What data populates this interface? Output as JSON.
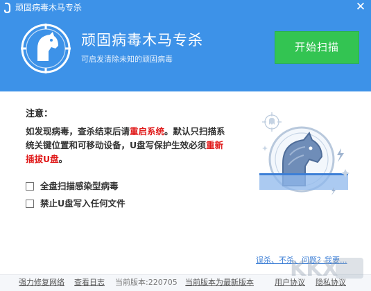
{
  "window": {
    "title": "顽固病毒木马专杀",
    "close_glyph": "✕"
  },
  "hero": {
    "title": "顽固病毒木马专杀",
    "subtitle": "可启发清除未知的顽固病毒",
    "scan_button": "开始扫描"
  },
  "notice": {
    "heading": "注意：",
    "text_1": "如发现病毒，查杀结束后请",
    "text_red_1": "重启系统",
    "text_2": "。默认只扫描系统关键位置和可移动设备，U盘写保护生效必须",
    "text_red_2": "重新插拔U盘",
    "text_3": "。"
  },
  "options": [
    {
      "label": "全盘扫描感染型病毒",
      "checked": false
    },
    {
      "label": "禁止U盘写入任何文件",
      "checked": false
    }
  ],
  "feedback_link": "误杀、不杀、问题？我要...",
  "footer": {
    "repair": "强力修复网络",
    "log": "查看日志",
    "version": "当前版本:220705",
    "latest": "当前版本为最新版本",
    "agreement": "用户协议",
    "privacy": "隐私协议"
  },
  "watermark_text": "KKX下载",
  "colors": {
    "header_blue": "#3d92e8",
    "scan_green": "#33c452",
    "warning_red": "#e01a1a",
    "link_blue": "#3d7fd6"
  },
  "icons": {
    "app_logo": "app-logo-icon",
    "hero_logo": "horse-shield-icon",
    "close": "close-icon",
    "illustration": "horse-scan-illustration"
  }
}
